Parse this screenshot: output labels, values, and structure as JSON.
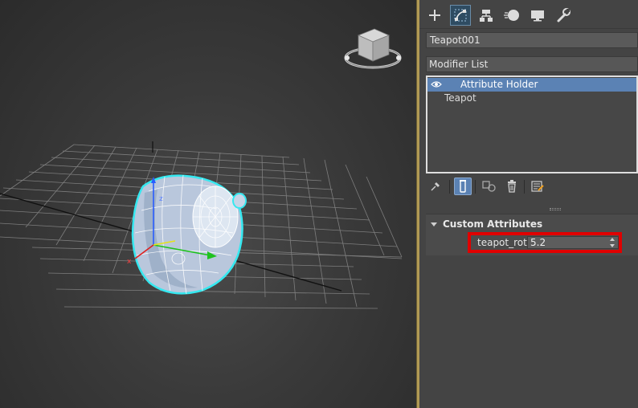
{
  "colors": {
    "selection": "#5b82b4",
    "active_tab": "#2f4c62",
    "highlight_box": "#e00000",
    "viewport_divider": "#b19a55",
    "teapot_outline": "#35e8f0"
  },
  "viewport": {
    "viewcube_icon": "viewcube-icon",
    "object_icon": "teapot-mesh-icon"
  },
  "command_panel": {
    "tabs": [
      {
        "icon": "plus-icon",
        "name": "create"
      },
      {
        "icon": "modify-icon",
        "name": "modify",
        "active": true
      },
      {
        "icon": "hierarchy-icon",
        "name": "hierarchy"
      },
      {
        "icon": "motion-icon",
        "name": "motion"
      },
      {
        "icon": "display-icon",
        "name": "display"
      },
      {
        "icon": "wrench-icon",
        "name": "utilities"
      }
    ],
    "object_name": "Teapot001",
    "modifier_list_label": "Modifier List",
    "stack": [
      {
        "label": "Attribute Holder",
        "selected": true,
        "icon": "eye-icon"
      },
      {
        "label": "Teapot",
        "selected": false
      }
    ],
    "stack_tools": [
      "pin-icon",
      "show-end-result-icon",
      "make-unique-icon",
      "trash-icon",
      "configure-icon"
    ],
    "rollout": {
      "title": "Custom Attributes",
      "param_label": "teapot_rot:",
      "param_value": "5.2"
    }
  }
}
